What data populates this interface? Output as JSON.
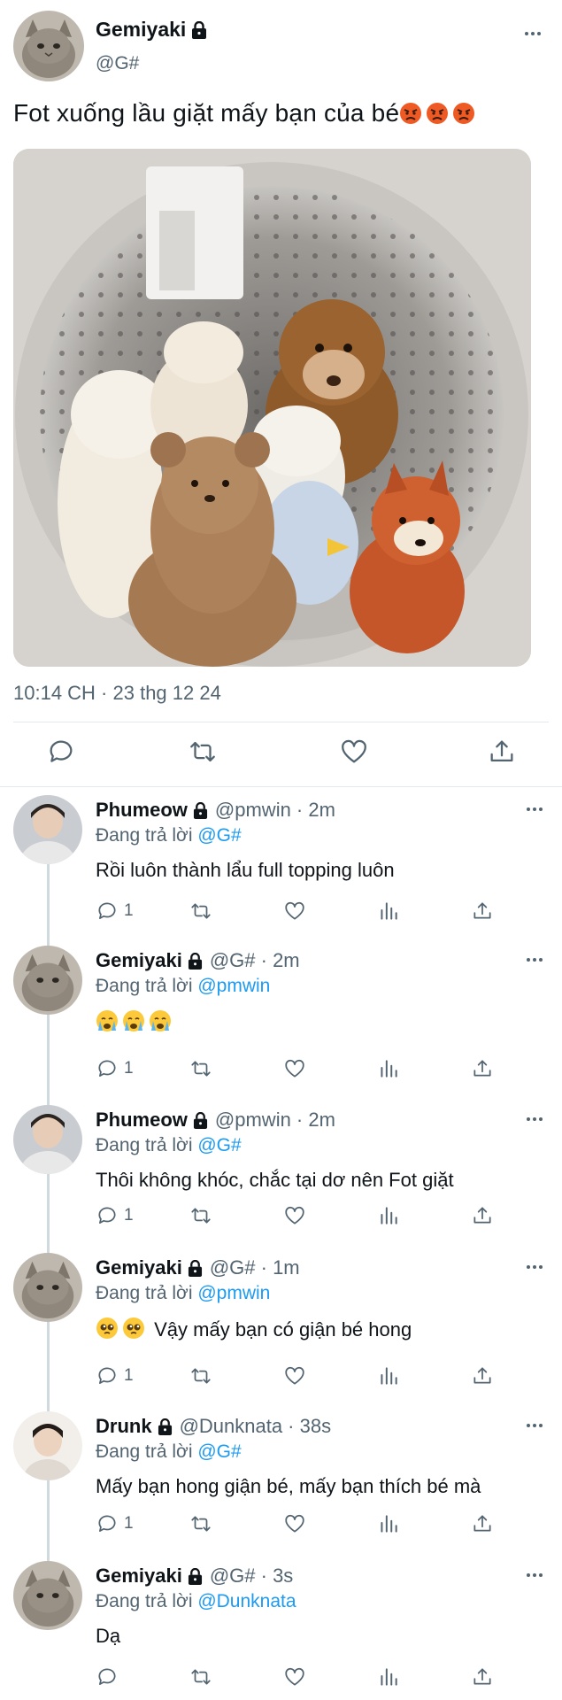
{
  "colors": {
    "accent": "#1d9bf0",
    "muted": "#536471",
    "text": "#0f1419",
    "divider": "#e6e9ec"
  },
  "tweet": {
    "author_name": "Gemiyaki",
    "author_handle": "@G#",
    "text": "Fot xuống lầu giặt mấy bạn của bé",
    "emojis": [
      "angry-face-icon",
      "angry-face-icon",
      "angry-face-icon"
    ],
    "timestamp": "10:14 CH · 23 thg 12 24",
    "actions": [
      "reply-icon",
      "retweet-icon",
      "like-icon",
      "share-icon"
    ]
  },
  "replies": [
    {
      "name": "Phumeow",
      "meta": "@pmwin · 2m",
      "replying_prefix": "Đang trả lời",
      "mention": "@G#",
      "text": "Rồi luôn thành lẩu full topping luôn",
      "reply_count": "1",
      "avatar": "person-avatar"
    },
    {
      "name": "Gemiyaki",
      "meta": "@G# · 2m",
      "replying_prefix": "Đang trả lời",
      "mention": "@pmwin",
      "text": "",
      "emojis": [
        "crying-face-icon",
        "crying-face-icon",
        "crying-face-icon"
      ],
      "reply_count": "1",
      "avatar": "cat-avatar"
    },
    {
      "name": "Phumeow",
      "meta": "@pmwin · 2m",
      "replying_prefix": "Đang trả lời",
      "mention": "@G#",
      "text": "Thôi không khóc, chắc tại dơ nên Fot giặt",
      "reply_count": "1",
      "avatar": "person-avatar"
    },
    {
      "name": "Gemiyaki",
      "meta": "@G# · 1m",
      "replying_prefix": "Đang trả lời",
      "mention": "@pmwin",
      "text": "Vậy mấy bạn có giận bé hong",
      "emojis": [
        "pleading-face-icon",
        "pleading-face-icon"
      ],
      "reply_count": "1",
      "avatar": "cat-avatar"
    },
    {
      "name": "Drunk",
      "meta": "@Dunknata · 38s",
      "replying_prefix": "Đang trả lời",
      "mention": "@G#",
      "text": "Mấy bạn hong giận bé, mấy bạn thích bé mà",
      "reply_count": "1",
      "avatar": "person-avatar-2"
    },
    {
      "name": "Gemiyaki",
      "meta": "@G# · 3s",
      "replying_prefix": "Đang trả lời",
      "mention": "@Dunknata",
      "text": "Dạ",
      "reply_count": "",
      "avatar": "cat-avatar"
    }
  ]
}
